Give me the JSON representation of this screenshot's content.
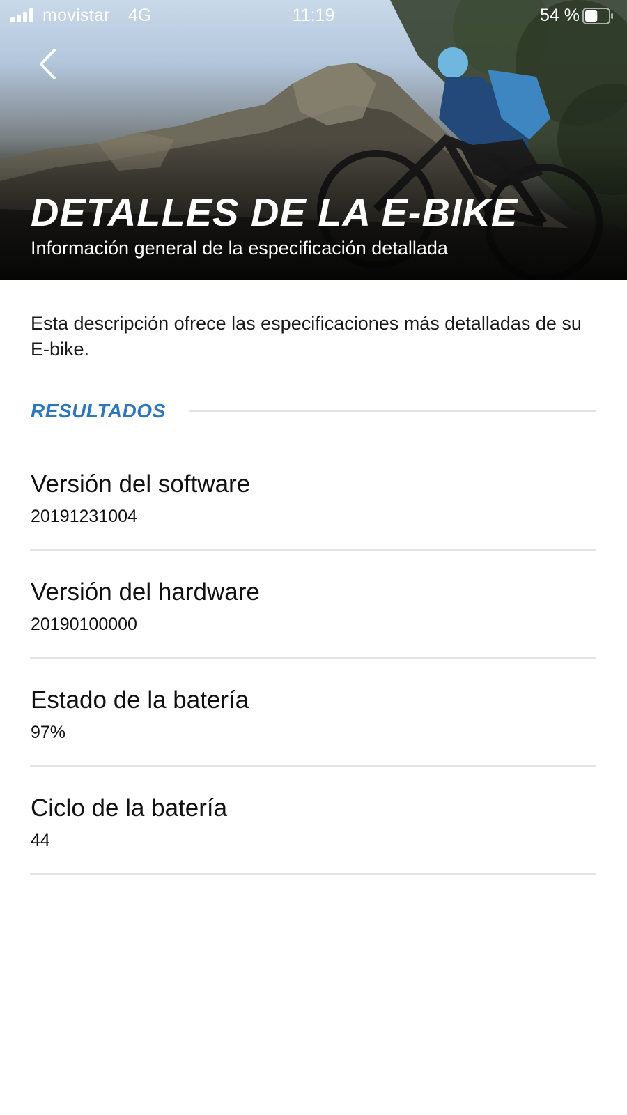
{
  "status_bar": {
    "carrier": "movistar",
    "network": "4G",
    "time": "11:19",
    "battery_percent": "54 %",
    "battery_level": 0.54
  },
  "header": {
    "title": "DETALLES DE LA E-BIKE",
    "subtitle": "Información general de la especificación detallada"
  },
  "intro": "Esta descripción ofrece las especificaciones más detalladas de su E-bike.",
  "section": {
    "title": "RESULTADOS",
    "color": "#2f77bb"
  },
  "specs": [
    {
      "label": "Versión del software",
      "value": "20191231004"
    },
    {
      "label": "Versión del hardware",
      "value": "20190100000"
    },
    {
      "label": "Estado de la batería",
      "value": "97%"
    },
    {
      "label": "Ciclo de la batería",
      "value": "44"
    }
  ],
  "icons": {
    "back": "chevron-left-icon",
    "signal": "cellular-signal-icon",
    "battery": "battery-icon"
  }
}
